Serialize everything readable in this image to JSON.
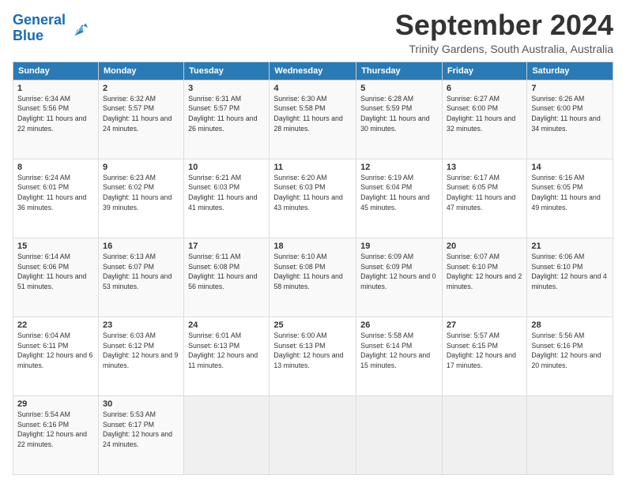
{
  "logo": {
    "line1": "General",
    "line2": "Blue"
  },
  "title": "September 2024",
  "location": "Trinity Gardens, South Australia, Australia",
  "headers": [
    "Sunday",
    "Monday",
    "Tuesday",
    "Wednesday",
    "Thursday",
    "Friday",
    "Saturday"
  ],
  "weeks": [
    [
      {
        "day": "1",
        "sunrise": "Sunrise: 6:34 AM",
        "sunset": "Sunset: 5:56 PM",
        "daylight": "Daylight: 11 hours and 22 minutes."
      },
      {
        "day": "2",
        "sunrise": "Sunrise: 6:32 AM",
        "sunset": "Sunset: 5:57 PM",
        "daylight": "Daylight: 11 hours and 24 minutes."
      },
      {
        "day": "3",
        "sunrise": "Sunrise: 6:31 AM",
        "sunset": "Sunset: 5:57 PM",
        "daylight": "Daylight: 11 hours and 26 minutes."
      },
      {
        "day": "4",
        "sunrise": "Sunrise: 6:30 AM",
        "sunset": "Sunset: 5:58 PM",
        "daylight": "Daylight: 11 hours and 28 minutes."
      },
      {
        "day": "5",
        "sunrise": "Sunrise: 6:28 AM",
        "sunset": "Sunset: 5:59 PM",
        "daylight": "Daylight: 11 hours and 30 minutes."
      },
      {
        "day": "6",
        "sunrise": "Sunrise: 6:27 AM",
        "sunset": "Sunset: 6:00 PM",
        "daylight": "Daylight: 11 hours and 32 minutes."
      },
      {
        "day": "7",
        "sunrise": "Sunrise: 6:26 AM",
        "sunset": "Sunset: 6:00 PM",
        "daylight": "Daylight: 11 hours and 34 minutes."
      }
    ],
    [
      {
        "day": "8",
        "sunrise": "Sunrise: 6:24 AM",
        "sunset": "Sunset: 6:01 PM",
        "daylight": "Daylight: 11 hours and 36 minutes."
      },
      {
        "day": "9",
        "sunrise": "Sunrise: 6:23 AM",
        "sunset": "Sunset: 6:02 PM",
        "daylight": "Daylight: 11 hours and 39 minutes."
      },
      {
        "day": "10",
        "sunrise": "Sunrise: 6:21 AM",
        "sunset": "Sunset: 6:03 PM",
        "daylight": "Daylight: 11 hours and 41 minutes."
      },
      {
        "day": "11",
        "sunrise": "Sunrise: 6:20 AM",
        "sunset": "Sunset: 6:03 PM",
        "daylight": "Daylight: 11 hours and 43 minutes."
      },
      {
        "day": "12",
        "sunrise": "Sunrise: 6:19 AM",
        "sunset": "Sunset: 6:04 PM",
        "daylight": "Daylight: 11 hours and 45 minutes."
      },
      {
        "day": "13",
        "sunrise": "Sunrise: 6:17 AM",
        "sunset": "Sunset: 6:05 PM",
        "daylight": "Daylight: 11 hours and 47 minutes."
      },
      {
        "day": "14",
        "sunrise": "Sunrise: 6:16 AM",
        "sunset": "Sunset: 6:05 PM",
        "daylight": "Daylight: 11 hours and 49 minutes."
      }
    ],
    [
      {
        "day": "15",
        "sunrise": "Sunrise: 6:14 AM",
        "sunset": "Sunset: 6:06 PM",
        "daylight": "Daylight: 11 hours and 51 minutes."
      },
      {
        "day": "16",
        "sunrise": "Sunrise: 6:13 AM",
        "sunset": "Sunset: 6:07 PM",
        "daylight": "Daylight: 11 hours and 53 minutes."
      },
      {
        "day": "17",
        "sunrise": "Sunrise: 6:11 AM",
        "sunset": "Sunset: 6:08 PM",
        "daylight": "Daylight: 11 hours and 56 minutes."
      },
      {
        "day": "18",
        "sunrise": "Sunrise: 6:10 AM",
        "sunset": "Sunset: 6:08 PM",
        "daylight": "Daylight: 11 hours and 58 minutes."
      },
      {
        "day": "19",
        "sunrise": "Sunrise: 6:09 AM",
        "sunset": "Sunset: 6:09 PM",
        "daylight": "Daylight: 12 hours and 0 minutes."
      },
      {
        "day": "20",
        "sunrise": "Sunrise: 6:07 AM",
        "sunset": "Sunset: 6:10 PM",
        "daylight": "Daylight: 12 hours and 2 minutes."
      },
      {
        "day": "21",
        "sunrise": "Sunrise: 6:06 AM",
        "sunset": "Sunset: 6:10 PM",
        "daylight": "Daylight: 12 hours and 4 minutes."
      }
    ],
    [
      {
        "day": "22",
        "sunrise": "Sunrise: 6:04 AM",
        "sunset": "Sunset: 6:11 PM",
        "daylight": "Daylight: 12 hours and 6 minutes."
      },
      {
        "day": "23",
        "sunrise": "Sunrise: 6:03 AM",
        "sunset": "Sunset: 6:12 PM",
        "daylight": "Daylight: 12 hours and 9 minutes."
      },
      {
        "day": "24",
        "sunrise": "Sunrise: 6:01 AM",
        "sunset": "Sunset: 6:13 PM",
        "daylight": "Daylight: 12 hours and 11 minutes."
      },
      {
        "day": "25",
        "sunrise": "Sunrise: 6:00 AM",
        "sunset": "Sunset: 6:13 PM",
        "daylight": "Daylight: 12 hours and 13 minutes."
      },
      {
        "day": "26",
        "sunrise": "Sunrise: 5:58 AM",
        "sunset": "Sunset: 6:14 PM",
        "daylight": "Daylight: 12 hours and 15 minutes."
      },
      {
        "day": "27",
        "sunrise": "Sunrise: 5:57 AM",
        "sunset": "Sunset: 6:15 PM",
        "daylight": "Daylight: 12 hours and 17 minutes."
      },
      {
        "day": "28",
        "sunrise": "Sunrise: 5:56 AM",
        "sunset": "Sunset: 6:16 PM",
        "daylight": "Daylight: 12 hours and 20 minutes."
      }
    ],
    [
      {
        "day": "29",
        "sunrise": "Sunrise: 5:54 AM",
        "sunset": "Sunset: 6:16 PM",
        "daylight": "Daylight: 12 hours and 22 minutes."
      },
      {
        "day": "30",
        "sunrise": "Sunrise: 5:53 AM",
        "sunset": "Sunset: 6:17 PM",
        "daylight": "Daylight: 12 hours and 24 minutes."
      },
      null,
      null,
      null,
      null,
      null
    ]
  ]
}
